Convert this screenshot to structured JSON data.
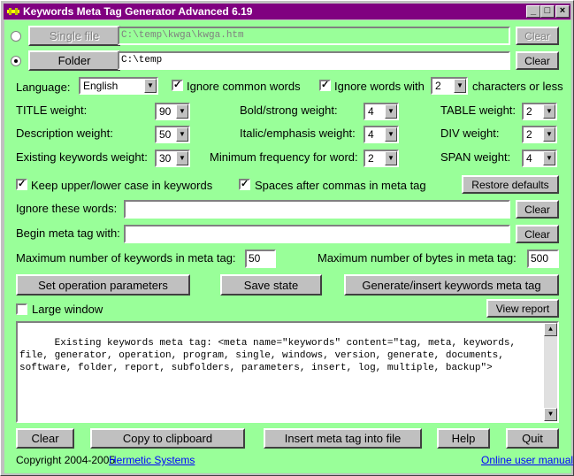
{
  "window": {
    "title": "Keywords Meta Tag Generator Advanced 6.19",
    "minimize": "_",
    "maximize": "□",
    "close": "×"
  },
  "source": {
    "single_file_label": "Single file",
    "single_file_path": "C:\\temp\\kwga\\kwga.htm",
    "single_file_selected": false,
    "folder_label": "Folder",
    "folder_path": "C:\\temp",
    "folder_selected": true,
    "clear_label": "Clear"
  },
  "language": {
    "label": "Language:",
    "value": "English"
  },
  "options": {
    "ignore_common_label": "Ignore common words",
    "ignore_common_checked": true,
    "ignore_words_with_label": "Ignore words with",
    "ignore_words_with_checked": true,
    "ignore_chars_value": "2",
    "chars_or_less_label": "characters or less"
  },
  "weights": {
    "title_label": "TITLE weight:",
    "title_value": "90",
    "description_label": "Description weight:",
    "description_value": "50",
    "existing_label": "Existing keywords weight:",
    "existing_value": "30",
    "bold_label": "Bold/strong weight:",
    "bold_value": "4",
    "italic_label": "Italic/emphasis weight:",
    "italic_value": "4",
    "minfreq_label": "Minimum frequency for word:",
    "minfreq_value": "2",
    "table_label": "TABLE weight:",
    "table_value": "2",
    "div_label": "DIV weight:",
    "div_value": "2",
    "span_label": "SPAN weight:",
    "span_value": "4"
  },
  "case": {
    "keep_case_label": "Keep upper/lower case in keywords",
    "keep_case_checked": true,
    "spaces_label": "Spaces after commas in meta tag",
    "spaces_checked": true,
    "restore_label": "Restore defaults"
  },
  "ignore_words": {
    "label": "Ignore these words:",
    "value": "",
    "clear_label": "Clear"
  },
  "begin_tag": {
    "label": "Begin meta tag with:",
    "value": "",
    "clear_label": "Clear"
  },
  "limits": {
    "max_keywords_label": "Maximum number of keywords in meta tag:",
    "max_keywords_value": "50",
    "max_bytes_label": "Maximum number of bytes in meta tag:",
    "max_bytes_value": "500"
  },
  "actions": {
    "set_params": "Set operation parameters",
    "save_state": "Save state",
    "generate": "Generate/insert keywords meta tag",
    "large_window_label": "Large window",
    "large_window_checked": false,
    "view_report": "View report"
  },
  "output": "Existing keywords meta tag: <meta name=\"keywords\" content=\"tag, meta, keywords, file, generator, operation, program, single, windows, version, generate, documents, software, folder, report, subfolders, parameters, insert, log, multiple, backup\">",
  "bottom": {
    "clear": "Clear",
    "copy": "Copy to clipboard",
    "insert": "Insert meta tag into file",
    "help": "Help",
    "quit": "Quit"
  },
  "footer": {
    "copyright": "Copyright 2004-2005",
    "company": "Hermetic Systems",
    "manual": "Online user manual"
  },
  "icons": {
    "dropdown": "▼",
    "scroll_up": "▲",
    "scroll_down": "▼",
    "check": "✓"
  }
}
